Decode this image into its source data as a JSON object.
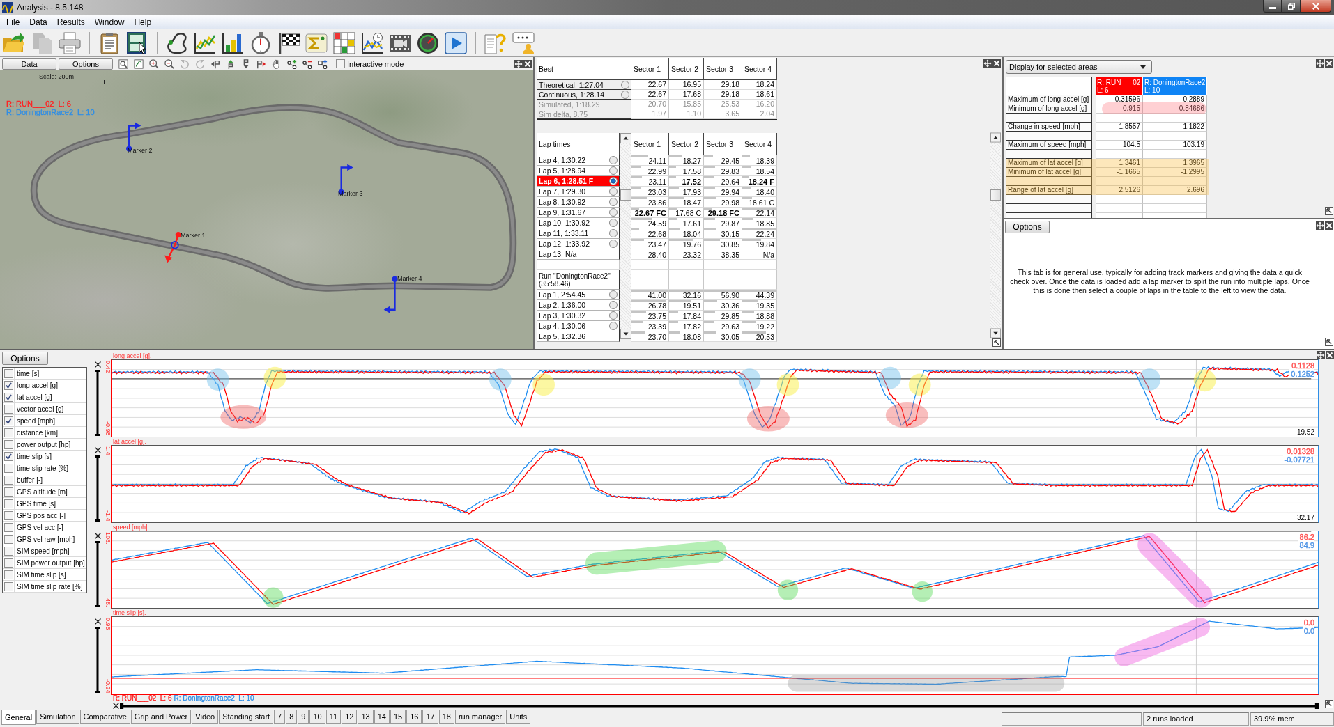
{
  "window": {
    "title": "Analysis - 8.5.148"
  },
  "menu": [
    "File",
    "Data",
    "Results",
    "Window",
    "Help"
  ],
  "toolbar": [
    [
      {
        "kind": "open",
        "disabled": false
      },
      {
        "kind": "paste",
        "disabled": true
      },
      {
        "kind": "print",
        "disabled": false
      }
    ],
    [
      {
        "kind": "clipboard",
        "disabled": false
      },
      {
        "kind": "xy",
        "disabled": false
      }
    ],
    [
      {
        "kind": "track",
        "disabled": false
      },
      {
        "kind": "linechart",
        "disabled": false
      },
      {
        "kind": "barchart",
        "disabled": false
      },
      {
        "kind": "stopwatch",
        "disabled": false
      },
      {
        "kind": "flag",
        "disabled": false
      },
      {
        "kind": "sigma",
        "disabled": false
      },
      {
        "kind": "grid",
        "disabled": false
      },
      {
        "kind": "timechart",
        "disabled": false
      },
      {
        "kind": "film",
        "disabled": false
      },
      {
        "kind": "gauge",
        "disabled": false
      },
      {
        "kind": "play",
        "disabled": false
      }
    ],
    [
      {
        "kind": "help",
        "disabled": false
      },
      {
        "kind": "chat",
        "disabled": false
      }
    ]
  ],
  "map": {
    "buttons": [
      "Data",
      "Options"
    ],
    "tools": [
      {
        "kind": "zoombox",
        "disabled": false
      },
      {
        "kind": "fit",
        "disabled": false
      },
      {
        "kind": "zoomin",
        "disabled": false
      },
      {
        "kind": "zoomout",
        "disabled": false
      },
      {
        "kind": "rotleft",
        "disabled": true
      },
      {
        "kind": "rotright",
        "disabled": true
      },
      {
        "kind": "markleft",
        "disabled": false
      },
      {
        "kind": "markup",
        "disabled": false
      },
      {
        "kind": "markdown",
        "disabled": false
      },
      {
        "kind": "markright",
        "disabled": false
      },
      {
        "kind": "hand",
        "disabled": false
      },
      {
        "kind": "nodeadd",
        "disabled": false
      },
      {
        "kind": "noderemove",
        "disabled": false
      },
      {
        "kind": "pointadd",
        "disabled": false
      }
    ],
    "interactive": {
      "label": "Interactive mode",
      "checked": false
    },
    "scale": "Scale: 200m",
    "runs": [
      {
        "label": "R: RUN___02  L: 6",
        "color": "#ff2020"
      },
      {
        "label": "R: DoningtonRace2  L: 10",
        "color": "#2f8ee6"
      }
    ],
    "markers": [
      {
        "label": "Marker 2",
        "selected": false
      },
      {
        "label": "Marker 3",
        "selected": false
      },
      {
        "label": "Marker 1",
        "selected": true
      },
      {
        "label": "Marker 4",
        "selected": false
      }
    ]
  },
  "best_table": {
    "title": "Best",
    "columns": [
      "Sector 1",
      "Sector 2",
      "Sector 3",
      "Sector 4"
    ],
    "rows": [
      {
        "label": "Theoretical,  1:27.04",
        "radio": true,
        "selected": false,
        "disabled": false,
        "cells": [
          "22.67",
          "16.95",
          "29.18",
          "18.24"
        ]
      },
      {
        "label": "Continuous, 1:28.14",
        "radio": true,
        "selected": false,
        "disabled": false,
        "cells": [
          "22.67",
          "17.68",
          "29.18",
          "18.61"
        ]
      },
      {
        "label": "Simulated, 1:18.29",
        "radio": false,
        "selected": false,
        "disabled": true,
        "cells": [
          "20.70",
          "15.85",
          "25.53",
          "16.20"
        ]
      },
      {
        "label": "Sim delta, 8.75",
        "radio": false,
        "selected": false,
        "disabled": true,
        "cells": [
          "1.97",
          "1.10",
          "3.65",
          "2.04"
        ]
      }
    ]
  },
  "lap_table": {
    "title": "Lap times",
    "columns": [
      "Sector 1",
      "Sector 2",
      "Sector 3",
      "Sector 4"
    ],
    "sections": [
      {
        "laps": [
          {
            "label": "Lap 4, 1:30.22",
            "radio": true,
            "selected": false,
            "cells": [
              {
                "text": "24.11",
                "level": 0.45,
                "bold": false
              },
              {
                "text": "18.27",
                "level": 0.37,
                "bold": false
              },
              {
                "text": "29.45",
                "level": 0.24,
                "bold": false
              },
              {
                "text": "18.39",
                "level": 0.23,
                "bold": false
              }
            ]
          },
          {
            "label": "Lap 5, 1:28.94",
            "radio": true,
            "selected": false,
            "cells": [
              {
                "text": "22.99",
                "level": 0.26,
                "bold": false
              },
              {
                "text": "17.58",
                "level": 0.21,
                "bold": false
              },
              {
                "text": "29.83",
                "level": 0.29,
                "bold": false
              },
              {
                "text": "18.54",
                "level": 0.27,
                "bold": false
              }
            ]
          },
          {
            "label": "Lap 6, 1:28.51 F",
            "radio": true,
            "selected": true,
            "cells": [
              {
                "text": "23.11",
                "level": 0.28,
                "bold": false
              },
              {
                "text": "17.52",
                "level": 0.2,
                "bold": true
              },
              {
                "text": "29.64",
                "level": 0.26,
                "bold": false
              },
              {
                "text": "18.24 F",
                "level": 0.2,
                "bold": true
              }
            ]
          },
          {
            "label": "Lap 7, 1:29.30",
            "radio": true,
            "selected": false,
            "cells": [
              {
                "text": "23.03",
                "level": 0.26,
                "bold": false
              },
              {
                "text": "17.93",
                "level": 0.29,
                "bold": false
              },
              {
                "text": "29.94",
                "level": 0.3,
                "bold": false
              },
              {
                "text": "18.40",
                "level": 0.24,
                "bold": false
              }
            ]
          },
          {
            "label": "Lap 8, 1:30.92",
            "radio": true,
            "selected": false,
            "cells": [
              {
                "text": "23.86",
                "level": 0.41,
                "bold": false
              },
              {
                "text": "18.47",
                "level": 0.42,
                "bold": false
              },
              {
                "text": "29.98",
                "level": 0.31,
                "bold": false
              },
              {
                "text": "18.61 C",
                "level": 0.28,
                "bold": false
              }
            ]
          },
          {
            "label": "Lap 9, 1:31.67",
            "radio": true,
            "selected": false,
            "cells": [
              {
                "text": "22.67 FC",
                "level": 0.2,
                "bold": true
              },
              {
                "text": "17.68 C",
                "level": 0.24,
                "bold": false
              },
              {
                "text": "29.18 FC",
                "level": 0.2,
                "bold": true
              },
              {
                "text": "22.14",
                "level": 1,
                "bold": false
              }
            ]
          },
          {
            "label": "Lap 10, 1:30.92",
            "radio": true,
            "selected": false,
            "cells": [
              {
                "text": "24.59",
                "level": 0.54,
                "bold": false
              },
              {
                "text": "17.61",
                "level": 0.22,
                "bold": false
              },
              {
                "text": "29.87",
                "level": 0.29,
                "bold": false
              },
              {
                "text": "18.85",
                "level": 0.33,
                "bold": false
              }
            ]
          },
          {
            "label": "Lap 11, 1:33.11",
            "radio": true,
            "selected": false,
            "cells": [
              {
                "text": "22.68",
                "level": 0.2,
                "bold": false
              },
              {
                "text": "18.04",
                "level": 0.32,
                "bold": false
              },
              {
                "text": "30.15",
                "level": 0.33,
                "bold": false
              },
              {
                "text": "22.24",
                "level": 1,
                "bold": false
              }
            ]
          },
          {
            "label": "Lap 12, 1:33.92",
            "radio": true,
            "selected": false,
            "cells": [
              {
                "text": "23.47",
                "level": 0.34,
                "bold": false
              },
              {
                "text": "19.76",
                "level": 0.71,
                "bold": false
              },
              {
                "text": "30.85",
                "level": 0.43,
                "bold": false
              },
              {
                "text": "19.84",
                "level": 0.55,
                "bold": false
              }
            ]
          },
          {
            "label": "Lap 13, N/a",
            "radio": false,
            "selected": false,
            "cells": [
              {
                "text": "28.40",
                "bold": false
              },
              {
                "text": "23.32",
                "bold": false
              },
              {
                "text": "38.35",
                "bold": false
              },
              {
                "text": "N/a",
                "bold": false
              }
            ]
          }
        ]
      },
      {
        "title": "Run \"DoningtonRace2\" (35:58.46)",
        "laps": [
          {
            "label": "Lap 1, 2:54.45",
            "radio": true,
            "selected": false,
            "cells": [
              {
                "text": "41.00",
                "level": 1,
                "bold": false
              },
              {
                "text": "32.16",
                "level": 1,
                "bold": false
              },
              {
                "text": "56.90",
                "level": 1,
                "bold": false
              },
              {
                "text": "44.39",
                "level": 1,
                "bold": false
              }
            ]
          },
          {
            "label": "Lap 2, 1:36.00",
            "radio": true,
            "selected": false,
            "cells": [
              {
                "text": "26.78",
                "level": 0.93,
                "bold": false
              },
              {
                "text": "19.51",
                "level": 0.65,
                "bold": false
              },
              {
                "text": "30.36",
                "level": 0.36,
                "bold": false
              },
              {
                "text": "19.35",
                "level": 0.44,
                "bold": false
              }
            ]
          },
          {
            "label": "Lap 3, 1:30.32",
            "radio": true,
            "selected": false,
            "cells": [
              {
                "text": "23.75",
                "level": 0.39,
                "bold": false
              },
              {
                "text": "17.84",
                "level": 0.27,
                "bold": false
              },
              {
                "text": "29.85",
                "level": 0.29,
                "bold": false
              },
              {
                "text": "18.88",
                "level": 0.34,
                "bold": false
              }
            ]
          },
          {
            "label": "Lap 4, 1:30.06",
            "radio": true,
            "selected": false,
            "cells": [
              {
                "text": "23.39",
                "level": 0.33,
                "bold": false
              },
              {
                "text": "17.82",
                "level": 0.27,
                "bold": false
              },
              {
                "text": "29.63",
                "level": 0.26,
                "bold": false
              },
              {
                "text": "19.22",
                "level": 0.41,
                "bold": false
              }
            ]
          },
          {
            "label": "Lap 5, 1:32.36",
            "radio": false,
            "selected": false,
            "cells": [
              {
                "text": "23.70",
                "level": 0.38,
                "bold": false
              },
              {
                "text": "18.08",
                "level": 0.33,
                "bold": false
              },
              {
                "text": "30.05",
                "level": 0.32,
                "bold": false
              },
              {
                "text": "20.53",
                "level": 0.7,
                "bold": false
              }
            ]
          }
        ]
      }
    ]
  },
  "stats": {
    "dropdown": "Display for selected areas",
    "runs": [
      {
        "name": "R: RUN___02",
        "lap": "L: 6",
        "color": "#ff0000"
      },
      {
        "name": "R: DoningtonRace2",
        "lap": "L: 10",
        "color": "#0f84f5"
      }
    ],
    "rows": [
      {
        "kind": "data",
        "label": "Maximum of long accel [g]",
        "values": [
          "0.31596",
          "0.2889"
        ],
        "circled": false,
        "shaded": false
      },
      {
        "kind": "data",
        "label": "Minimum of long accel [g]",
        "values": [
          "-0.915",
          "-0.84686"
        ],
        "circled": true,
        "shaded": false
      },
      {
        "kind": "blank",
        "circled": false,
        "shaded": false
      },
      {
        "kind": "data",
        "label": "Change in speed [mph]",
        "values": [
          "1.8557",
          "1.1822"
        ],
        "circled": false,
        "shaded": false
      },
      {
        "kind": "blank",
        "circled": false,
        "shaded": false
      },
      {
        "kind": "data",
        "label": "Maximum of speed [mph]",
        "values": [
          "104.5",
          "103.19"
        ],
        "circled": false,
        "shaded": false
      },
      {
        "kind": "blank",
        "circled": false,
        "shaded": false
      },
      {
        "kind": "data",
        "label": "Maximum of lat accel [g]",
        "values": [
          "1.3461",
          "1.3965"
        ],
        "circled": false,
        "shaded": true
      },
      {
        "kind": "data",
        "label": "Minimum of lat accel [g]",
        "values": [
          "-1.1665",
          "-1.2995"
        ],
        "circled": false,
        "shaded": true
      },
      {
        "kind": "blank",
        "circled": false,
        "shaded": true
      },
      {
        "kind": "data",
        "label": "Range of lat accel [g]",
        "values": [
          "2.5126",
          "2.696"
        ],
        "circled": false,
        "shaded": true
      },
      {
        "kind": "blank",
        "circled": false,
        "shaded": false
      },
      {
        "kind": "blank",
        "circled": false,
        "shaded": false
      },
      {
        "kind": "blank",
        "circled": false,
        "shaded": false
      }
    ]
  },
  "info": {
    "button": "Options",
    "text": "This tab is for general use, typically for adding track markers and giving the data a quick check over. Once the data is loaded add a lap marker to split the run into multiple laps. Once this is done then select a couple of laps in the table to the left to view the data."
  },
  "channels": {
    "button": "Options",
    "items": [
      {
        "label": "time [s]",
        "checked": false
      },
      {
        "label": "long accel [g]",
        "checked": true
      },
      {
        "label": "lat accel [g]",
        "checked": true
      },
      {
        "label": "vector accel [g]",
        "checked": false
      },
      {
        "label": "speed [mph]",
        "checked": true
      },
      {
        "label": "distance [km]",
        "checked": false
      },
      {
        "label": "power output [hp]",
        "checked": false
      },
      {
        "label": "time slip [s]",
        "checked": true
      },
      {
        "label": "time slip rate [%]",
        "checked": false
      },
      {
        "label": "buffer [-]",
        "checked": false
      },
      {
        "label": "GPS altitude [m]",
        "checked": false
      },
      {
        "label": "GPS time [s]",
        "checked": false
      },
      {
        "label": "GPS pos acc [-]",
        "checked": false
      },
      {
        "label": "GPS vel acc [-]",
        "checked": false
      },
      {
        "label": "GPS vel raw [mph]",
        "checked": false
      },
      {
        "label": "SIM speed [mph]",
        "checked": false
      },
      {
        "label": "SIM power output [hp]",
        "checked": false
      },
      {
        "label": "SIM time slip [s]",
        "checked": false
      },
      {
        "label": "SIM time slip rate [%]",
        "checked": false
      }
    ]
  },
  "charts": [
    {
      "kind": "accel",
      "title": "long accel [g].",
      "y_max": "0.42",
      "y_min": "-0.98",
      "readings": [
        {
          "text": "0.1128",
          "color": "#ff5050"
        },
        {
          "text": "0.1252",
          "color": "#4f95e6"
        }
      ],
      "cursor": "19.52"
    },
    {
      "kind": "lateral",
      "title": "lat accel [g].",
      "y_max": "1.4",
      "y_min": "-1.4",
      "readings": [
        {
          "text": "0.01328",
          "color": "#ff5050"
        },
        {
          "text": "-0.07721",
          "color": "#4f95e6"
        }
      ],
      "cursor": "32.17"
    },
    {
      "kind": "speed",
      "title": "speed [mph].",
      "y_max": "108.",
      "y_min": "48.",
      "readings": [
        {
          "text": "86.2",
          "color": "#ff5050"
        },
        {
          "text": "84.9",
          "color": "#4f95e6"
        }
      ]
    },
    {
      "kind": "slip",
      "title": "time slip [s].",
      "y_max": "0.96",
      "y_min": "-0.24",
      "readings": [
        {
          "text": "0.0",
          "color": "#ff5050"
        },
        {
          "text": "0.0",
          "color": "#4f95e6"
        }
      ]
    }
  ],
  "chart_legend": [
    {
      "label": "R: RUN___02  L: 6",
      "color": "#ff2020"
    },
    {
      "label": "R: DoningtonRace2  L: 10",
      "color": "#2f8ee6"
    }
  ],
  "tabs": [
    {
      "label": "General",
      "selected": true
    },
    {
      "label": "Simulation",
      "selected": false
    },
    {
      "label": "Comparative",
      "selected": false
    },
    {
      "label": "Grip and Power",
      "selected": false
    },
    {
      "label": "Video",
      "selected": false
    },
    {
      "label": "Standing start",
      "selected": false
    },
    {
      "label": "7",
      "selected": false
    },
    {
      "label": "8",
      "selected": false
    },
    {
      "label": "9",
      "selected": false
    },
    {
      "label": "10",
      "selected": false
    },
    {
      "label": "11",
      "selected": false
    },
    {
      "label": "12",
      "selected": false
    },
    {
      "label": "13",
      "selected": false
    },
    {
      "label": "14",
      "selected": false
    },
    {
      "label": "15",
      "selected": false
    },
    {
      "label": "16",
      "selected": false
    },
    {
      "label": "17",
      "selected": false
    },
    {
      "label": "18",
      "selected": false
    },
    {
      "label": "run manager",
      "selected": false
    },
    {
      "label": "Units",
      "selected": false
    }
  ],
  "status": [
    "2 runs loaded",
    "39.9% mem"
  ]
}
